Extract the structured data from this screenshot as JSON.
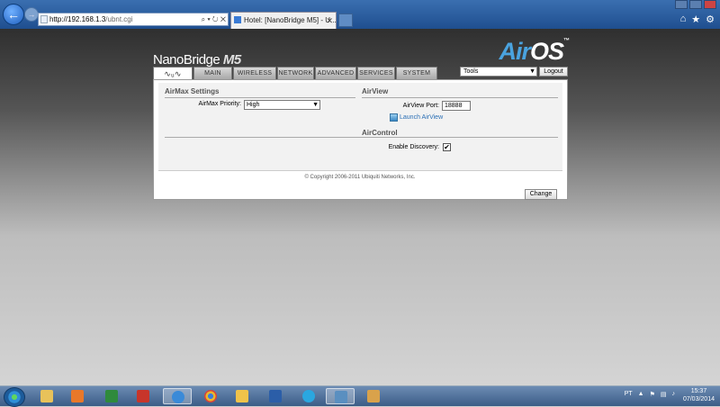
{
  "browser": {
    "url_host": "http://192.168.1.3",
    "url_path": "/ubnt.cgi",
    "address_tools": "⌕ ▾ ↻ ✕",
    "tab_title": "Hotel: [NanoBridge M5] - U...",
    "tab_close": "✕"
  },
  "header": {
    "brand": "NanoBridge",
    "model": "M5",
    "airos_air": "Air",
    "airos_os": "OS",
    "airos_tm": "™"
  },
  "nav": {
    "tabs": [
      {
        "label": "MAIN"
      },
      {
        "label": "WIRELESS"
      },
      {
        "label": "NETWORK"
      },
      {
        "label": "ADVANCED"
      },
      {
        "label": "SERVICES"
      },
      {
        "label": "SYSTEM"
      }
    ],
    "logo_glyph": "∿ᵤ∿",
    "tools_value": "Tools",
    "logout_label": "Logout"
  },
  "airmax": {
    "title": "AirMax Settings",
    "priority_label": "AirMax Priority:",
    "priority_value": "High"
  },
  "airview": {
    "title": "AirView",
    "port_label": "AirView Port:",
    "port_value": "18888",
    "launch_label": "Launch AirView"
  },
  "aircontrol": {
    "title": "AirControl",
    "discovery_label": "Enable Discovery:",
    "discovery_checked": "✔"
  },
  "form": {
    "change_label": "Change"
  },
  "footer": {
    "copyright": "© Copyright 2006-2011 Ubiquiti Networks, Inc."
  },
  "taskbar": {
    "language": "PT",
    "time": "15:37",
    "date": "07/03/2014"
  },
  "colors": {
    "accent_link": "#2a6fb5",
    "airos_blue": "#4aa3df",
    "taskbar": "#3b5c86"
  }
}
